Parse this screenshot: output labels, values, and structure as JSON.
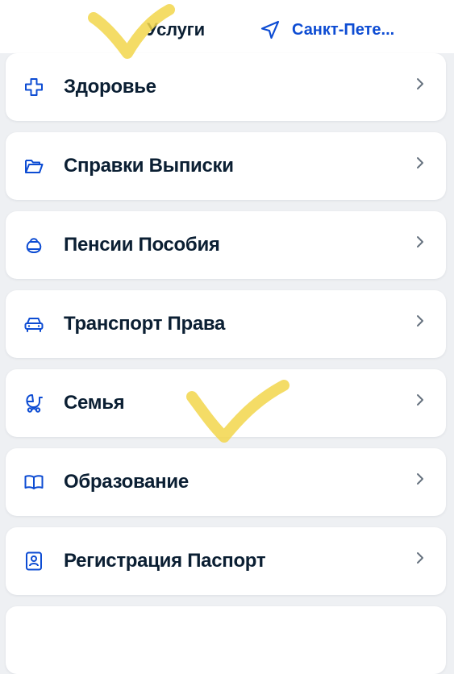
{
  "header": {
    "title": "Услуги",
    "location_label": "Санкт-Пете..."
  },
  "services": [
    {
      "label": "Здоровье",
      "icon": "plus-cross-icon"
    },
    {
      "label": "Справки Выписки",
      "icon": "folder-icon"
    },
    {
      "label": "Пенсии Пособия",
      "icon": "coin-purse-icon"
    },
    {
      "label": "Транспорт Права",
      "icon": "car-icon"
    },
    {
      "label": "Семья",
      "icon": "stroller-icon"
    },
    {
      "label": "Образование",
      "icon": "open-book-icon"
    },
    {
      "label": "Регистрация Паспорт",
      "icon": "passport-icon"
    }
  ],
  "colors": {
    "accent": "#0d4cd3",
    "text": "#0b1f33",
    "background": "#eef0f3",
    "card": "#ffffff",
    "chevron": "#66727f",
    "highlighter_mark": "#f2d64b"
  }
}
